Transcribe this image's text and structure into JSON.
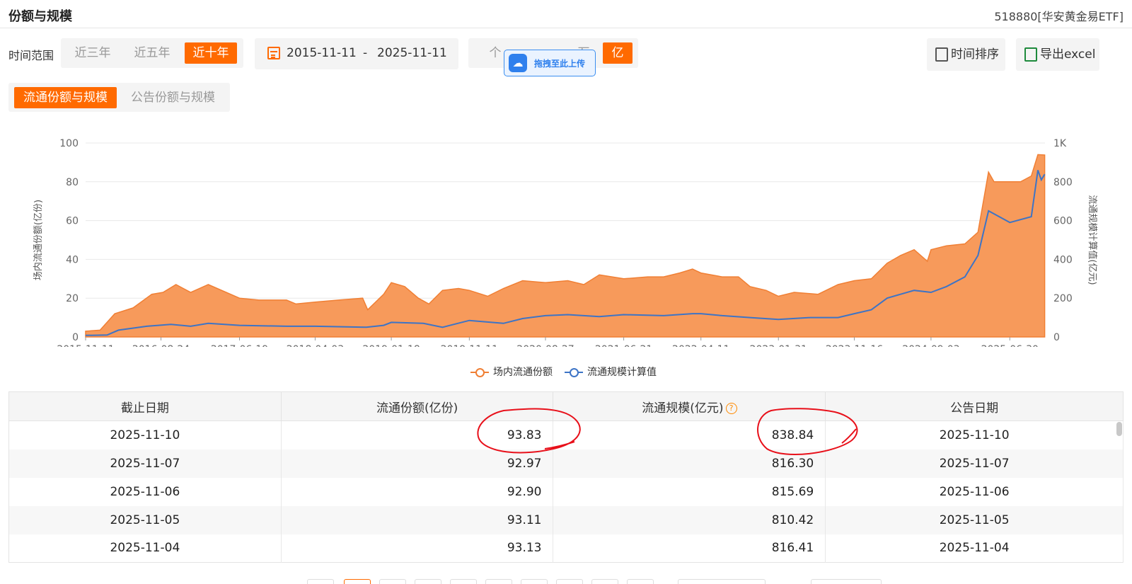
{
  "header": {
    "title": "份额与规模",
    "fund": "518880[华安黄金易ETF]"
  },
  "filters": {
    "time_range_label": "时间范围",
    "ranges": [
      "近三年",
      "近五年",
      "近十年"
    ],
    "active_range": "近十年",
    "date_from": "2015-11-11",
    "date_sep": "-",
    "date_to": "2025-11-11",
    "units": [
      "个",
      "万",
      "亿"
    ],
    "active_unit": "亿"
  },
  "upload_tip": "拖拽至此上传",
  "actions": {
    "sort": "时间排序",
    "export": "导出excel"
  },
  "tabs": [
    "流通份额与规模",
    "公告份额与规模"
  ],
  "active_tab": "流通份额与规模",
  "colors": {
    "accent": "#ff6a00",
    "area": "#f79a5b",
    "line": "#3d74c6"
  },
  "chart_data": {
    "type": "area",
    "x_ticks": [
      "2015-11-11",
      "2016-08-24",
      "2017-06-19",
      "2018-04-03",
      "2019-01-18",
      "2019-11-11",
      "2020-08-27",
      "2021-06-21",
      "2022-04-11",
      "2023-01-31",
      "2023-11-16",
      "2024-09-03",
      "2025-06-30"
    ],
    "y_left": {
      "label": "场内流通份额(亿份)",
      "ticks": [
        "100",
        "80",
        "60",
        "40",
        "20",
        "0"
      ],
      "range": [
        0,
        100
      ]
    },
    "y_right": {
      "label": "流通规模计算值(亿元)",
      "ticks": [
        "1K",
        "800",
        "600",
        "400",
        "200",
        "0"
      ],
      "range": [
        0,
        1000
      ]
    },
    "x_range": [
      "2015-11-11",
      "2025-11-11"
    ],
    "series": [
      {
        "name": "场内流通份额",
        "axis": "left",
        "points": [
          [
            "2015-11-11",
            3
          ],
          [
            "2016-01-05",
            3.5
          ],
          [
            "2016-03-01",
            12
          ],
          [
            "2016-05-10",
            15
          ],
          [
            "2016-07-20",
            22
          ],
          [
            "2016-09-01",
            23
          ],
          [
            "2016-10-20",
            27
          ],
          [
            "2016-12-15",
            23
          ],
          [
            "2017-02-20",
            27
          ],
          [
            "2017-06-19",
            20
          ],
          [
            "2017-09-01",
            19
          ],
          [
            "2017-12-15",
            19
          ],
          [
            "2018-01-20",
            17
          ],
          [
            "2018-04-03",
            18
          ],
          [
            "2018-07-01",
            19
          ],
          [
            "2018-10-01",
            20
          ],
          [
            "2018-10-20",
            14
          ],
          [
            "2018-12-20",
            22
          ],
          [
            "2019-01-18",
            28
          ],
          [
            "2019-03-10",
            26
          ],
          [
            "2019-05-01",
            20
          ],
          [
            "2019-06-10",
            17
          ],
          [
            "2019-08-01",
            24
          ],
          [
            "2019-10-01",
            25
          ],
          [
            "2019-11-11",
            24
          ],
          [
            "2020-01-20",
            21
          ],
          [
            "2020-03-20",
            25
          ],
          [
            "2020-06-01",
            29
          ],
          [
            "2020-08-27",
            28
          ],
          [
            "2020-11-20",
            29
          ],
          [
            "2021-01-20",
            27
          ],
          [
            "2021-03-20",
            32
          ],
          [
            "2021-06-21",
            30
          ],
          [
            "2021-09-20",
            31
          ],
          [
            "2021-11-20",
            31
          ],
          [
            "2022-01-20",
            33
          ],
          [
            "2022-03-10",
            35
          ],
          [
            "2022-04-11",
            33
          ],
          [
            "2022-07-01",
            31
          ],
          [
            "2022-09-01",
            31
          ],
          [
            "2022-10-15",
            26
          ],
          [
            "2022-12-15",
            24
          ],
          [
            "2023-01-31",
            21
          ],
          [
            "2023-04-01",
            23
          ],
          [
            "2023-07-01",
            22
          ],
          [
            "2023-09-15",
            27
          ],
          [
            "2023-11-16",
            29
          ],
          [
            "2024-01-20",
            30
          ],
          [
            "2024-03-20",
            38
          ],
          [
            "2024-05-10",
            42
          ],
          [
            "2024-07-01",
            45
          ],
          [
            "2024-08-20",
            39
          ],
          [
            "2024-09-03",
            45
          ],
          [
            "2024-11-01",
            47
          ],
          [
            "2025-01-10",
            48
          ],
          [
            "2025-03-01",
            54
          ],
          [
            "2025-04-10",
            85
          ],
          [
            "2025-05-01",
            80
          ],
          [
            "2025-06-30",
            80
          ],
          [
            "2025-08-10",
            80
          ],
          [
            "2025-09-20",
            83
          ],
          [
            "2025-10-15",
            94
          ],
          [
            "2025-11-10",
            93.83
          ]
        ]
      },
      {
        "name": "流通规模计算值",
        "axis": "right",
        "points": [
          [
            "2015-11-11",
            8
          ],
          [
            "2016-02-01",
            10
          ],
          [
            "2016-03-15",
            35
          ],
          [
            "2016-07-01",
            55
          ],
          [
            "2016-10-01",
            65
          ],
          [
            "2016-12-15",
            55
          ],
          [
            "2017-02-20",
            70
          ],
          [
            "2017-06-19",
            60
          ],
          [
            "2017-12-15",
            55
          ],
          [
            "2018-04-03",
            55
          ],
          [
            "2018-10-15",
            50
          ],
          [
            "2018-12-20",
            60
          ],
          [
            "2019-01-18",
            75
          ],
          [
            "2019-05-20",
            70
          ],
          [
            "2019-08-01",
            50
          ],
          [
            "2019-11-11",
            85
          ],
          [
            "2020-03-20",
            70
          ],
          [
            "2020-06-01",
            95
          ],
          [
            "2020-08-27",
            110
          ],
          [
            "2020-11-20",
            115
          ],
          [
            "2021-03-20",
            105
          ],
          [
            "2021-06-21",
            115
          ],
          [
            "2021-11-20",
            110
          ],
          [
            "2022-03-10",
            120
          ],
          [
            "2022-04-11",
            120
          ],
          [
            "2022-07-01",
            110
          ],
          [
            "2022-10-15",
            100
          ],
          [
            "2023-01-31",
            90
          ],
          [
            "2023-06-01",
            100
          ],
          [
            "2023-09-15",
            100
          ],
          [
            "2023-11-16",
            120
          ],
          [
            "2024-01-20",
            140
          ],
          [
            "2024-03-20",
            200
          ],
          [
            "2024-05-10",
            220
          ],
          [
            "2024-07-01",
            240
          ],
          [
            "2024-09-03",
            230
          ],
          [
            "2024-11-01",
            260
          ],
          [
            "2025-01-10",
            310
          ],
          [
            "2025-03-01",
            420
          ],
          [
            "2025-04-10",
            650
          ],
          [
            "2025-06-30",
            590
          ],
          [
            "2025-09-20",
            620
          ],
          [
            "2025-10-15",
            860
          ],
          [
            "2025-10-28",
            810
          ],
          [
            "2025-11-10",
            838.84
          ]
        ]
      }
    ]
  },
  "table": {
    "headers": [
      "截止日期",
      "流通份额(亿份)",
      "流通规模(亿元)",
      "公告日期"
    ],
    "help_glyph": "?",
    "rows": [
      [
        "2025-11-10",
        "93.83",
        "838.84",
        "2025-11-10"
      ],
      [
        "2025-11-07",
        "92.97",
        "816.30",
        "2025-11-07"
      ],
      [
        "2025-11-06",
        "92.90",
        "815.69",
        "2025-11-06"
      ],
      [
        "2025-11-05",
        "93.11",
        "810.42",
        "2025-11-05"
      ],
      [
        "2025-11-04",
        "93.13",
        "816.41",
        "2025-11-04"
      ]
    ]
  }
}
